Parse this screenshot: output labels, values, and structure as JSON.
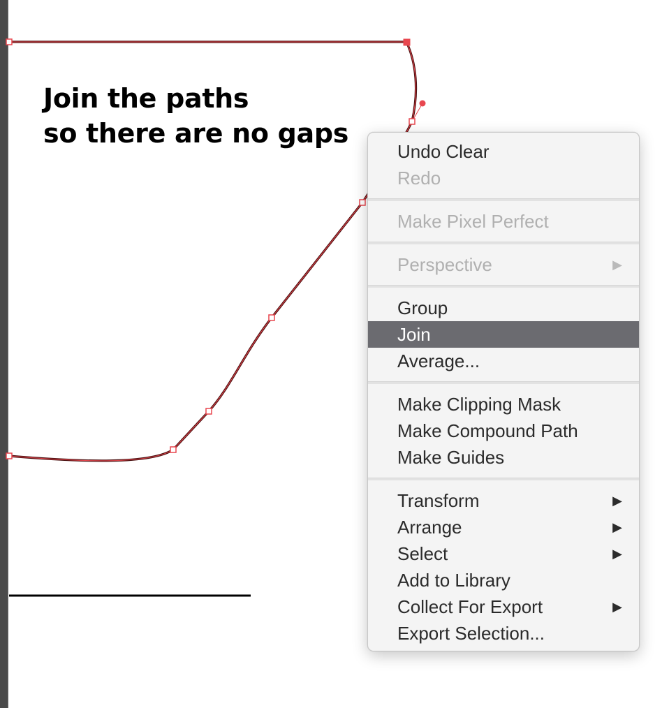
{
  "instruction": {
    "line1": "Join the paths",
    "line2": "so there are no gaps"
  },
  "colors": {
    "path_stroke": "#8b1a1a",
    "anchor": "#e8474f",
    "menu_highlight": "#6b6b70",
    "disabled_text": "#b0b0b0"
  },
  "context_menu": {
    "groups": [
      [
        {
          "label": "Undo Clear",
          "enabled": true
        },
        {
          "label": "Redo",
          "enabled": false
        }
      ],
      [
        {
          "label": "Make Pixel Perfect",
          "enabled": false
        }
      ],
      [
        {
          "label": "Perspective",
          "enabled": false,
          "submenu": true,
          "icon": "chevron-right-icon"
        }
      ],
      [
        {
          "label": "Group",
          "enabled": true
        },
        {
          "label": "Join",
          "enabled": true,
          "highlighted": true
        },
        {
          "label": "Average...",
          "enabled": true
        }
      ],
      [
        {
          "label": "Make Clipping Mask",
          "enabled": true
        },
        {
          "label": "Make Compound Path",
          "enabled": true
        },
        {
          "label": "Make Guides",
          "enabled": true
        }
      ],
      [
        {
          "label": "Transform",
          "enabled": true,
          "submenu": true,
          "icon": "chevron-right-icon"
        },
        {
          "label": "Arrange",
          "enabled": true,
          "submenu": true,
          "icon": "chevron-right-icon"
        },
        {
          "label": "Select",
          "enabled": true,
          "submenu": true,
          "icon": "chevron-right-icon"
        },
        {
          "label": "Add to Library",
          "enabled": true
        },
        {
          "label": "Collect For Export",
          "enabled": true,
          "submenu": true,
          "icon": "chevron-right-icon"
        },
        {
          "label": "Export Selection...",
          "enabled": true
        }
      ]
    ],
    "submenu_glyph": "▶"
  }
}
